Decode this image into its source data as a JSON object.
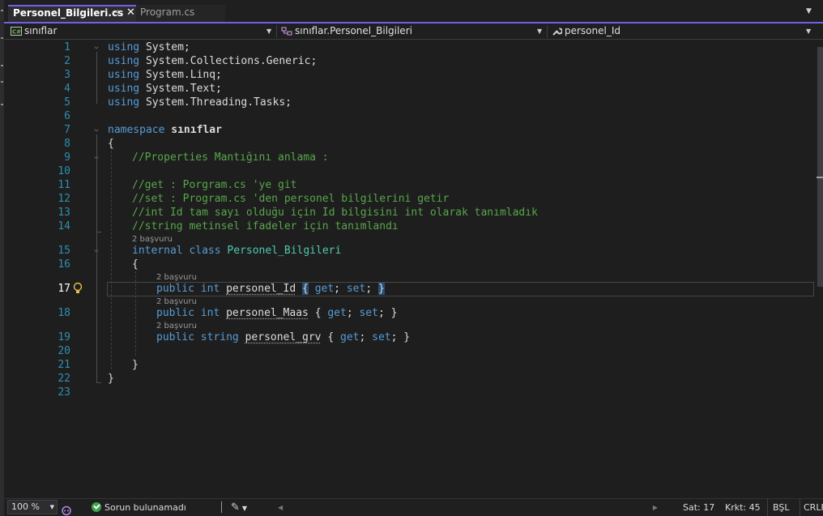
{
  "tabs": [
    {
      "label": "Personel_Bilgileri.cs",
      "active": true,
      "pin_glyph": "⊣",
      "close_glyph": "✕"
    },
    {
      "label": "Program.cs",
      "active": false
    }
  ],
  "navbar": {
    "project": "sınıflar",
    "class_path": "sınıflar.Personel_Bilgileri",
    "member": "personel_Id"
  },
  "editor": {
    "line_numbers": [
      "1",
      "2",
      "3",
      "4",
      "5",
      "6",
      "7",
      "8",
      "9",
      "10",
      "11",
      "12",
      "13",
      "14",
      "15",
      "16",
      "17",
      "18",
      "19",
      "20",
      "21",
      "22",
      "23"
    ],
    "current_line": "17",
    "lines": {
      "l1": {
        "kw": "using",
        "rest": "System;"
      },
      "l2": {
        "kw": "using",
        "rest": "System.Collections.Generic;"
      },
      "l3": {
        "kw": "using",
        "rest": "System.Linq;"
      },
      "l4": {
        "kw": "using",
        "rest": "System.Text;"
      },
      "l5": {
        "kw": "using",
        "rest": "System.Threading.Tasks;"
      },
      "l7": {
        "kw": "namespace",
        "name": "sınıflar"
      },
      "l8": "{",
      "l9": "//Properties Mantığını anlama :",
      "l11": "//get : Porgram.cs 'ye git",
      "l12": "//set : Program.cs 'den personel bilgilerini getir",
      "l13": "//int Id tam sayı olduğu için Id bilgisini int olarak tanımladık",
      "l14": "//string metinsel ifadeler için tanımlandı",
      "l15": {
        "kw1": "internal",
        "kw2": "class",
        "name": "Personel_Bilgileri"
      },
      "l16": "{",
      "l17": {
        "kw1": "public",
        "kw2": "int",
        "name": "personel_Id",
        "open": "{",
        "get": "get",
        "set": "set",
        "close": "}"
      },
      "l18": {
        "kw1": "public",
        "kw2": "int",
        "name": "personel_Maas",
        "open": "{",
        "get": "get",
        "set": "set",
        "close": "}"
      },
      "l19": {
        "kw1": "public",
        "kw2": "string",
        "name": "personel_grv",
        "open": "{",
        "get": "get",
        "set": "set",
        "close": "}"
      },
      "l21": "}",
      "l22": "}"
    },
    "codelens": "2 başvuru"
  },
  "statusbar": {
    "zoom": "100 %",
    "issues": "Sorun bulunamadı",
    "line": "Sat: 17",
    "col": "Krkt: 45",
    "encoding": "BŞL",
    "eol": "CRLF"
  },
  "colors": {
    "accent": "#7160e8",
    "keyword": "#569cd6",
    "type": "#4ec9b0",
    "comment": "#57a64a",
    "line_number": "#2b91af",
    "ok": "#3fa34d"
  },
  "icons": [
    "csharp-project-icon",
    "class-hierarchy-icon",
    "wrench-icon",
    "lightbulb-icon",
    "ok-check-icon",
    "copilot-icon",
    "brush-icon"
  ]
}
